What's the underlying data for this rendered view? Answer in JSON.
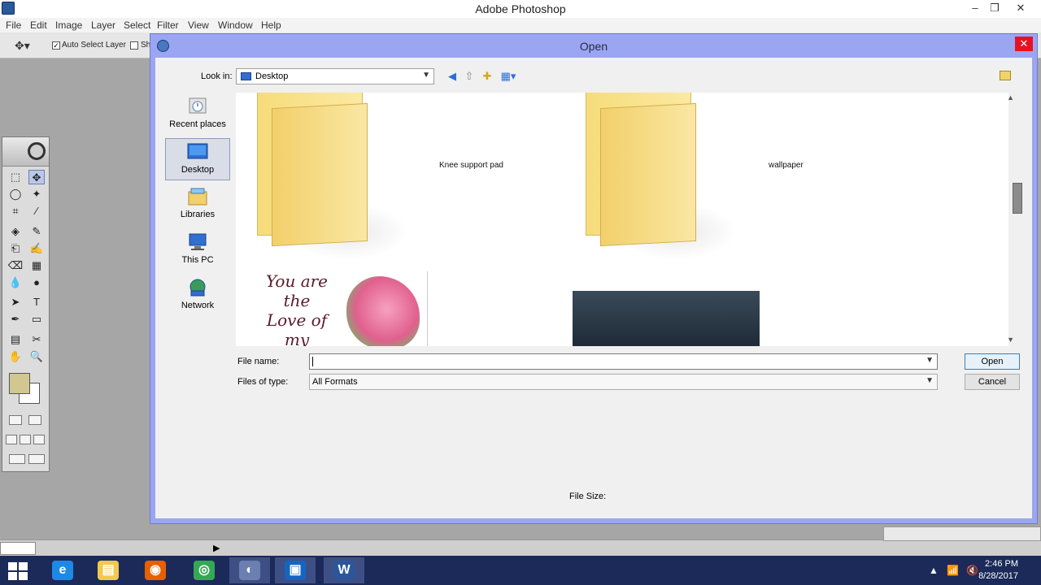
{
  "app": {
    "title": "Adobe Photoshop",
    "window_controls": [
      "–",
      "❐",
      "✕"
    ]
  },
  "menu": [
    "File",
    "Edit",
    "Image",
    "Layer",
    "Select",
    "Filter",
    "View",
    "Window",
    "Help"
  ],
  "options_bar": {
    "move_tool_glyph": "✥▾",
    "auto_select_label": "Auto Select Layer",
    "auto_select_checked": "✓",
    "show_label_partial": "Sh"
  },
  "toolbox": {
    "tools": [
      "⬚",
      "✥",
      "◯",
      "✦",
      "⌗",
      "∕",
      "◈",
      "✎",
      "⎗",
      "✍",
      "⌫",
      "▦",
      "💧",
      "●",
      "➤",
      "T",
      "✒",
      "▭",
      "▤",
      "✂",
      "✋",
      "🔍"
    ]
  },
  "dialog": {
    "title": "Open",
    "close_glyph": "✕",
    "look_in_label": "Look in:",
    "look_in_value": "Desktop",
    "places": [
      {
        "label": "Recent places",
        "icon": "recent-places-icon"
      },
      {
        "label": "Desktop",
        "icon": "desktop-icon"
      },
      {
        "label": "Libraries",
        "icon": "libraries-icon"
      },
      {
        "label": "This PC",
        "icon": "this-pc-icon"
      },
      {
        "label": "Network",
        "icon": "network-icon"
      }
    ],
    "files": [
      {
        "label": "Knee  support pad",
        "type": "folder"
      },
      {
        "label": "wallpaper",
        "type": "folder"
      }
    ],
    "rose_text": "You are the Love of my",
    "file_name_label": "File name:",
    "file_name_value": "",
    "files_of_type_label": "Files of type:",
    "files_of_type_value": "All Formats",
    "open_button": "Open",
    "cancel_button": "Cancel",
    "file_size_label": "File Size:"
  },
  "taskbar": {
    "apps": [
      {
        "name": "internet-explorer",
        "glyph": "e",
        "color": "#1e88e5"
      },
      {
        "name": "file-explorer",
        "glyph": "▤",
        "color": "#f2c94c"
      },
      {
        "name": "firefox",
        "glyph": "◉",
        "color": "#e66000"
      },
      {
        "name": "chrome",
        "glyph": "◎",
        "color": "#34a853"
      },
      {
        "name": "photoshop-task",
        "glyph": "◐",
        "color": "#6b7fb0"
      },
      {
        "name": "photoshop-alt",
        "glyph": "▣",
        "color": "#1565c0"
      },
      {
        "name": "word",
        "glyph": "W",
        "color": "#2b579a"
      }
    ],
    "time": "2:46 PM",
    "date": "8/28/2017"
  }
}
